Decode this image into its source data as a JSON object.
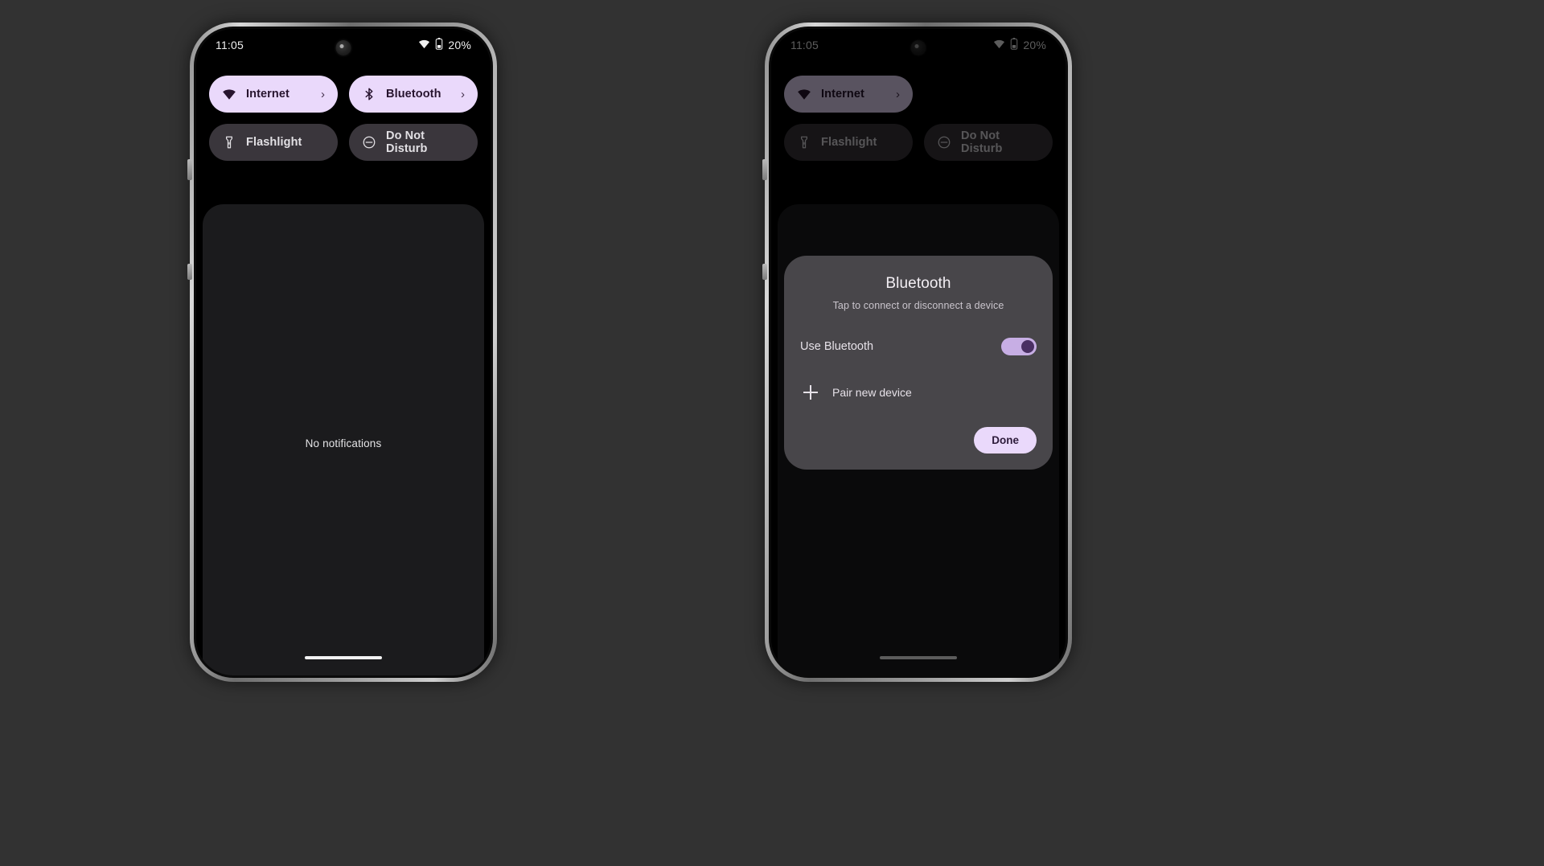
{
  "theme": {
    "page_bg": "#323232",
    "accent_on": "#ead9fb",
    "accent_on_text": "#27142e",
    "tile_off": "#3a363c",
    "dialog_bg": "#48464a",
    "shade_bg": "#1b1b1d",
    "toggle_track": "#c7aee4",
    "toggle_knob": "#4a2f63"
  },
  "phones": [
    {
      "id": "left",
      "name": "quick-settings-panel",
      "dimmed": false,
      "statusbar": {
        "time": "11:05",
        "wifi_icon": "wifi-icon",
        "battery_icon": "battery-icon",
        "battery_text": "20%"
      },
      "tiles": [
        {
          "label": "Internet",
          "icon": "wifi-icon",
          "state": "on",
          "chevron": "›"
        },
        {
          "label": "Bluetooth",
          "icon": "bluetooth-icon",
          "state": "on",
          "chevron": "›"
        },
        {
          "label": "Flashlight",
          "icon": "flashlight-icon",
          "state": "off",
          "chevron": ""
        },
        {
          "label": "Do Not Disturb",
          "icon": "dnd-icon",
          "state": "off",
          "chevron": ""
        }
      ],
      "shade": {
        "empty_text": "No notifications"
      }
    },
    {
      "id": "right",
      "name": "bluetooth-dialog-panel",
      "dimmed": true,
      "statusbar": {
        "time": "11:05",
        "wifi_icon": "wifi-icon",
        "battery_icon": "battery-icon",
        "battery_text": "20%"
      },
      "tiles": [
        {
          "label": "Internet",
          "icon": "wifi-icon",
          "state": "on",
          "chevron": "›"
        },
        {
          "label": "",
          "icon": "",
          "state": "hidden",
          "chevron": ""
        },
        {
          "label": "Flashlight",
          "icon": "flashlight-icon",
          "state": "off",
          "chevron": ""
        },
        {
          "label": "Do Not Disturb",
          "icon": "dnd-icon",
          "state": "off",
          "chevron": ""
        }
      ],
      "dialog": {
        "title": "Bluetooth",
        "subtitle": "Tap to connect or disconnect a device",
        "toggle_label": "Use Bluetooth",
        "toggle_state": "on",
        "pair_label": "Pair new device",
        "pair_icon": "plus-icon",
        "done_label": "Done"
      }
    }
  ]
}
